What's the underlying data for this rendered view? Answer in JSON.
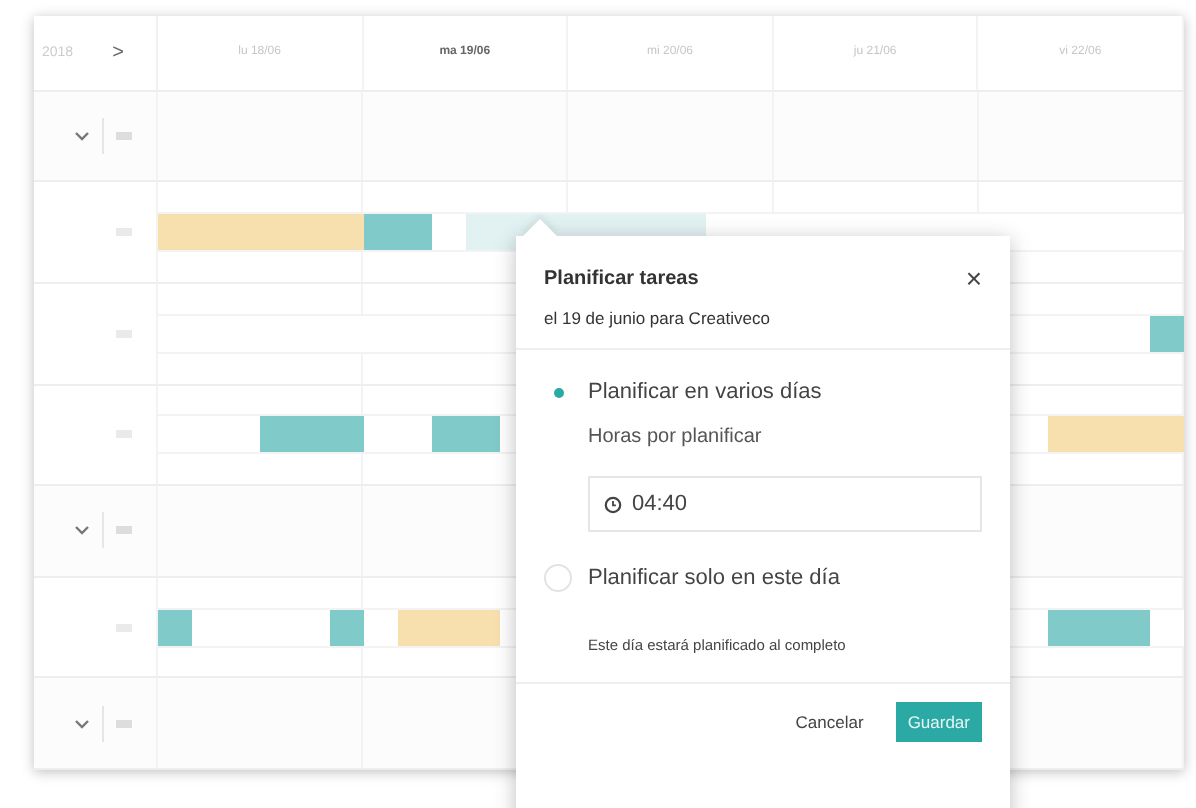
{
  "header": {
    "year": "2018",
    "next": ">",
    "days": [
      {
        "label": "lu 18/06",
        "selected": false
      },
      {
        "label": "ma 19/06",
        "selected": true
      },
      {
        "label": "mi 20/06",
        "selected": false
      },
      {
        "label": "ju 21/06",
        "selected": false
      },
      {
        "label": "vi 22/06",
        "selected": false
      }
    ]
  },
  "rows": [
    {
      "kind": "group"
    },
    {
      "kind": "task",
      "slots": [
        {
          "kind": "bar",
          "color": "#f8e0ae"
        },
        {
          "kind": "bar",
          "color": "#f8e0ae"
        },
        {
          "kind": "bar",
          "color": "#f8e0ae"
        },
        {
          "kind": "bar",
          "color": "#f8e0ae"
        },
        {
          "kind": "bar",
          "color": "#f8e0ae"
        },
        {
          "kind": "bar",
          "color": "#f8e0ae"
        },
        {
          "kind": "bar",
          "color": "#80cac9"
        },
        {
          "kind": "bar",
          "color": "#80cac9"
        },
        {
          "kind": "gap"
        },
        {
          "kind": "bar",
          "color": "#e2f1f2"
        },
        {
          "kind": "bar",
          "color": "#e2f1f2"
        },
        {
          "kind": "bar",
          "color": "#e2f1f2"
        },
        {
          "kind": "bar",
          "color": "#e2f1f2"
        },
        {
          "kind": "bar",
          "color": "#e2f1f2"
        },
        {
          "kind": "bar",
          "color": "#e2f1f2"
        },
        {
          "kind": "bar",
          "color": "#e2f1f2"
        }
      ]
    },
    {
      "kind": "task",
      "slots": [
        {
          "kind": "gap"
        },
        {
          "kind": "gap"
        },
        {
          "kind": "gap"
        },
        {
          "kind": "gap"
        },
        {
          "kind": "gap"
        },
        {
          "kind": "gap"
        },
        {
          "kind": "gap"
        },
        {
          "kind": "gap"
        },
        {
          "kind": "gap"
        },
        {
          "kind": "gap"
        },
        {
          "kind": "gap"
        },
        {
          "kind": "gap"
        },
        {
          "kind": "gap"
        },
        {
          "kind": "gap"
        },
        {
          "kind": "gap"
        },
        {
          "kind": "gap"
        },
        {
          "kind": "gap"
        },
        {
          "kind": "gap"
        },
        {
          "kind": "gap"
        },
        {
          "kind": "gap"
        },
        {
          "kind": "gap"
        },
        {
          "kind": "gap"
        },
        {
          "kind": "gap"
        },
        {
          "kind": "gap"
        },
        {
          "kind": "gap"
        },
        {
          "kind": "gap"
        },
        {
          "kind": "gap"
        },
        {
          "kind": "gap"
        },
        {
          "kind": "gap"
        },
        {
          "kind": "bar",
          "color": "#80cac9"
        }
      ]
    },
    {
      "kind": "task",
      "slots": [
        {
          "kind": "gap"
        },
        {
          "kind": "gap"
        },
        {
          "kind": "gap"
        },
        {
          "kind": "bar",
          "color": "#80cac9"
        },
        {
          "kind": "bar",
          "color": "#80cac9"
        },
        {
          "kind": "bar",
          "color": "#80cac9"
        },
        {
          "kind": "gap"
        },
        {
          "kind": "gap"
        },
        {
          "kind": "bar",
          "color": "#80cac9"
        },
        {
          "kind": "bar",
          "color": "#80cac9"
        },
        {
          "kind": "gap"
        },
        {
          "kind": "gap"
        },
        {
          "kind": "gap"
        },
        {
          "kind": "gap"
        },
        {
          "kind": "gap"
        },
        {
          "kind": "gap"
        },
        {
          "kind": "gap"
        },
        {
          "kind": "gap"
        },
        {
          "kind": "gap"
        },
        {
          "kind": "gap"
        },
        {
          "kind": "gap"
        },
        {
          "kind": "gap"
        },
        {
          "kind": "gap"
        },
        {
          "kind": "gap"
        },
        {
          "kind": "gap"
        },
        {
          "kind": "gap"
        },
        {
          "kind": "bar",
          "color": "#f8e0ae"
        },
        {
          "kind": "bar",
          "color": "#f8e0ae"
        },
        {
          "kind": "bar",
          "color": "#f8e0ae"
        },
        {
          "kind": "bar",
          "color": "#f8e0ae"
        }
      ]
    },
    {
      "kind": "group"
    },
    {
      "kind": "task",
      "slots": [
        {
          "kind": "bar",
          "color": "#80cac9"
        },
        {
          "kind": "gap"
        },
        {
          "kind": "gap"
        },
        {
          "kind": "gap"
        },
        {
          "kind": "gap"
        },
        {
          "kind": "bar",
          "color": "#80cac9"
        },
        {
          "kind": "gap"
        },
        {
          "kind": "bar",
          "color": "#f8e0ae"
        },
        {
          "kind": "bar",
          "color": "#f8e0ae"
        },
        {
          "kind": "bar",
          "color": "#f8e0ae"
        },
        {
          "kind": "gap"
        },
        {
          "kind": "gap"
        },
        {
          "kind": "gap"
        },
        {
          "kind": "gap"
        },
        {
          "kind": "gap"
        },
        {
          "kind": "gap"
        },
        {
          "kind": "gap"
        },
        {
          "kind": "gap"
        },
        {
          "kind": "gap"
        },
        {
          "kind": "gap"
        },
        {
          "kind": "gap"
        },
        {
          "kind": "gap"
        },
        {
          "kind": "gap"
        },
        {
          "kind": "gap"
        },
        {
          "kind": "gap"
        },
        {
          "kind": "gap"
        },
        {
          "kind": "bar",
          "color": "#80cac9"
        },
        {
          "kind": "bar",
          "color": "#80cac9"
        },
        {
          "kind": "bar",
          "color": "#80cac9"
        }
      ]
    },
    {
      "kind": "group"
    }
  ],
  "popover": {
    "title": "Planificar tareas",
    "close": "×",
    "subtitle": "el 19 de junio para Creativeco",
    "options": [
      {
        "label": "Planificar en varios días",
        "selected": true,
        "sublabel": "Horas por planificar",
        "value": "04:40"
      },
      {
        "label": "Planificar solo en este día",
        "selected": false
      }
    ],
    "note": "Este día estará planificado al completo",
    "buttons": [
      {
        "label": "Cancelar",
        "kind": "text"
      },
      {
        "label": "Guardar",
        "kind": "primary"
      }
    ]
  }
}
